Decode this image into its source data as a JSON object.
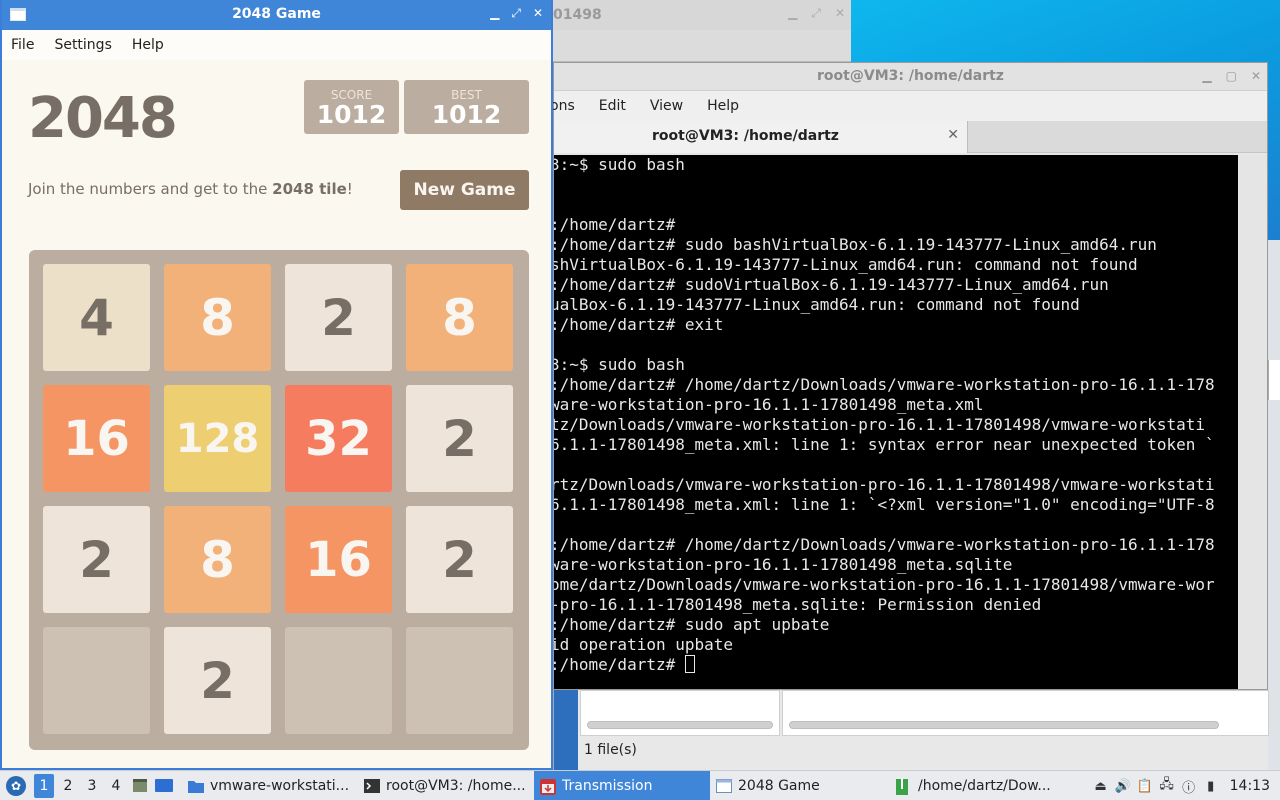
{
  "background_window": {
    "title": "01498"
  },
  "file_manager": {
    "status": "1 file(s)"
  },
  "terminal": {
    "title": "root@VM3: /home/dartz",
    "menu": [
      "ons",
      "Edit",
      "View",
      "Help"
    ],
    "tab_label": "root@VM3: /home/dartz",
    "lines": [
      "3:~$ sudo bash",
      "",
      "",
      ":/home/dartz#",
      ":/home/dartz# sudo bashVirtualBox-6.1.19-143777-Linux_amd64.run",
      "shVirtualBox-6.1.19-143777-Linux_amd64.run: command not found",
      ":/home/dartz# sudoVirtualBox-6.1.19-143777-Linux_amd64.run",
      "ualBox-6.1.19-143777-Linux_amd64.run: command not found",
      ":/home/dartz# exit",
      "",
      "3:~$ sudo bash",
      ":/home/dartz# /home/dartz/Downloads/vmware-workstation-pro-16.1.1-178",
      "ware-workstation-pro-16.1.1-17801498_meta.xml",
      "tz/Downloads/vmware-workstation-pro-16.1.1-17801498/vmware-workstati",
      "6.1.1-17801498_meta.xml: line 1: syntax error near unexpected token `",
      "",
      "rtz/Downloads/vmware-workstation-pro-16.1.1-17801498/vmware-workstati",
      "6.1.1-17801498_meta.xml: line 1: `<?xml version=\"1.0\" encoding=\"UTF-8",
      "",
      ":/home/dartz# /home/dartz/Downloads/vmware-workstation-pro-16.1.1-178",
      "ware-workstation-pro-16.1.1-17801498_meta.sqlite",
      "ome/dartz/Downloads/vmware-workstation-pro-16.1.1-17801498/vmware-wor",
      "-pro-16.1.1-17801498_meta.sqlite: Permission denied",
      ":/home/dartz# sudo apt upbate",
      "id operation upbate",
      ":/home/dartz# "
    ]
  },
  "game": {
    "window_title": "2048 Game",
    "menu": [
      "File",
      "Settings",
      "Help"
    ],
    "logo": "2048",
    "score_label": "SCORE",
    "score": "1012",
    "best_label": "BEST",
    "best": "1012",
    "intro_prefix": "Join the numbers and get to the ",
    "intro_bold": "2048 tile",
    "intro_suffix": "!",
    "new_game": "New Game",
    "grid": [
      [
        "4",
        "8",
        "2",
        "8"
      ],
      [
        "16",
        "128",
        "32",
        "2"
      ],
      [
        "2",
        "8",
        "16",
        "2"
      ],
      [
        "",
        "2",
        "",
        ""
      ]
    ],
    "tile_colors": {
      "2": {
        "bg": "#eee4da",
        "fg": "#776e65"
      },
      "4": {
        "bg": "#ede0c8",
        "fg": "#776e65"
      },
      "8": {
        "bg": "#f2b179",
        "fg": "#f9f6f2"
      },
      "16": {
        "bg": "#f59563",
        "fg": "#f9f6f2"
      },
      "32": {
        "bg": "#f67c5f",
        "fg": "#f9f6f2"
      },
      "128": {
        "bg": "#edcf72",
        "fg": "#f9f6f2"
      }
    }
  },
  "taskbar": {
    "workspaces": [
      "1",
      "2",
      "3",
      "4"
    ],
    "tasks": [
      {
        "label": "vmware-workstati...",
        "icon": "folder-icon"
      },
      {
        "label": "root@VM3: /home...",
        "icon": "terminal-icon"
      },
      {
        "label": "Transmission",
        "icon": "transmission-icon"
      },
      {
        "label": "2048 Game",
        "icon": "window-icon"
      },
      {
        "label": "/home/dartz/Dow...",
        "icon": "archive-icon"
      }
    ],
    "clock": "14:13"
  }
}
